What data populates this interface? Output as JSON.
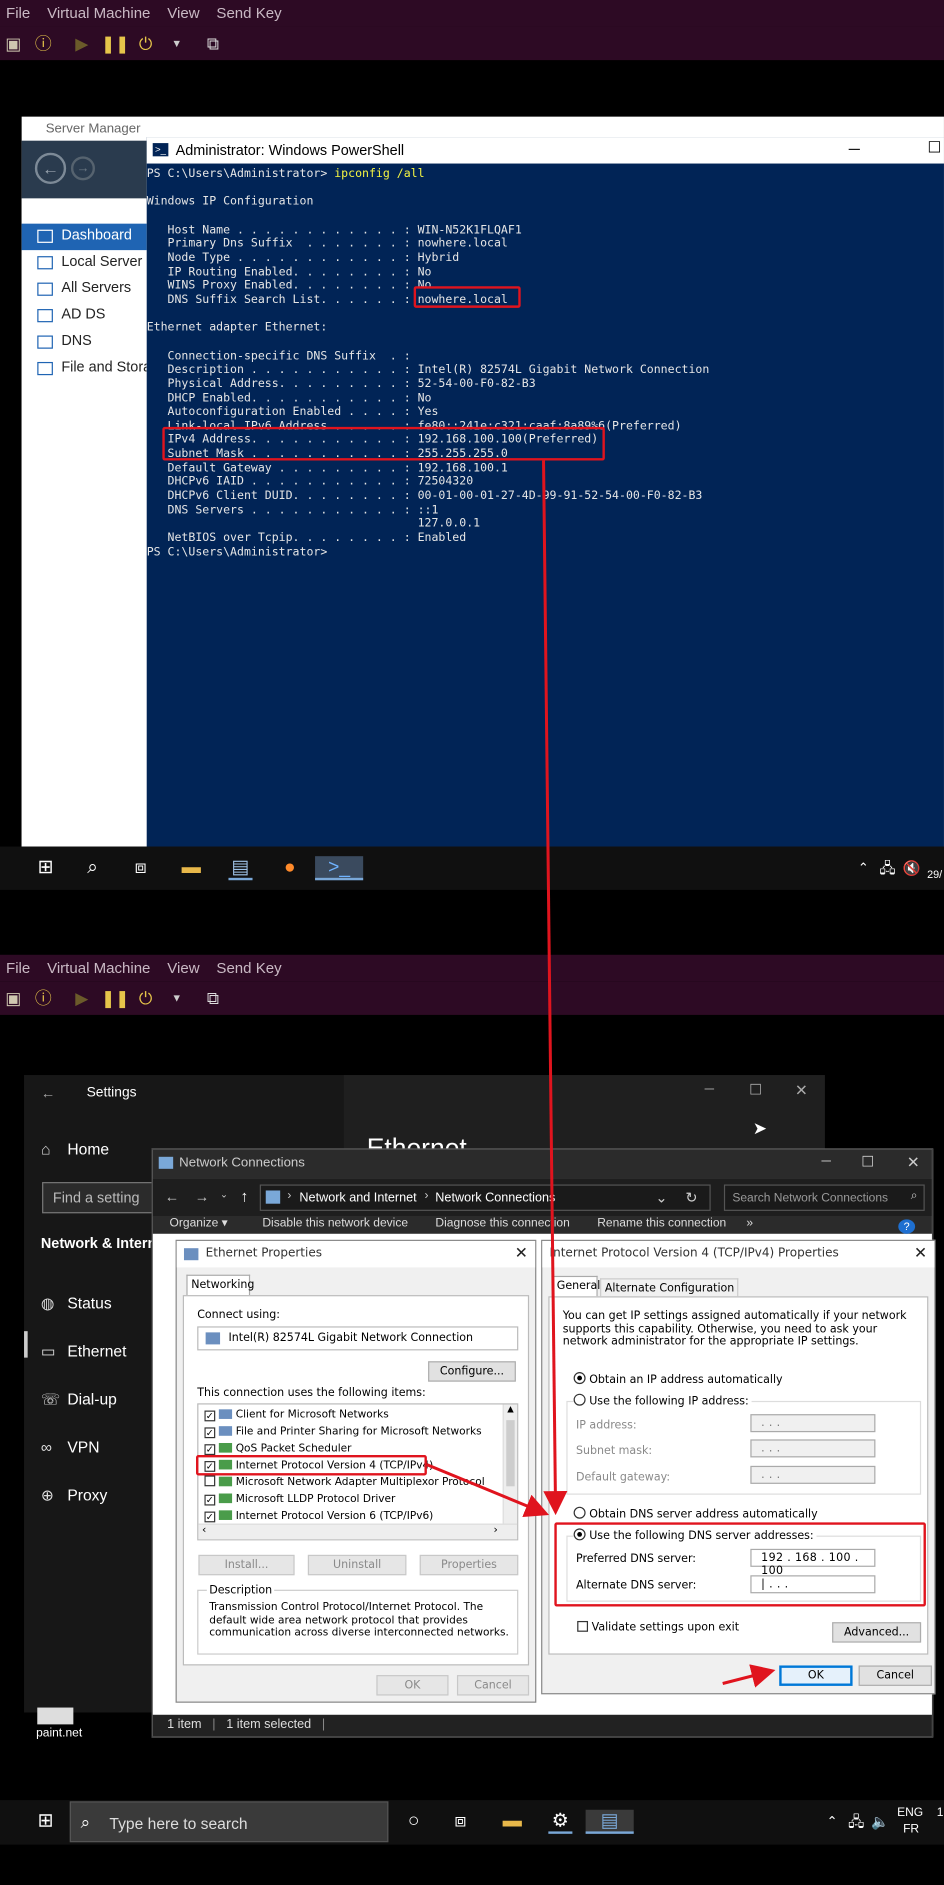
{
  "vm_top": {
    "menu": [
      "File",
      "Virtual Machine",
      "View",
      "Send Key"
    ]
  },
  "vm_bottom": {
    "menu": [
      "File",
      "Virtual Machine",
      "View",
      "Send Key"
    ]
  },
  "server_manager": {
    "title": "Server Manager",
    "items": [
      {
        "label": "Dashboard",
        "icon": "dashboard-icon"
      },
      {
        "label": "Local Server",
        "icon": "server-icon"
      },
      {
        "label": "All Servers",
        "icon": "servers-icon"
      },
      {
        "label": "AD DS",
        "icon": "adds-icon"
      },
      {
        "label": "DNS",
        "icon": "dns-icon"
      },
      {
        "label": "File and Stora",
        "icon": "files-icon"
      }
    ]
  },
  "powershell": {
    "title": "Administrator: Windows PowerShell",
    "prompt1": "PS C:\\Users\\Administrator> ",
    "command": "ipconfig /all",
    "lines": [
      "",
      "Windows IP Configuration",
      "",
      "   Host Name . . . . . . . . . . . . : WIN-N52K1FLQAF1",
      "   Primary Dns Suffix  . . . . . . . : nowhere.local",
      "   Node Type . . . . . . . . . . . . : Hybrid",
      "   IP Routing Enabled. . . . . . . . : No",
      "   WINS Proxy Enabled. . . . . . . . : No",
      "   DNS Suffix Search List. . . . . . : nowhere.local",
      "",
      "Ethernet adapter Ethernet:",
      "",
      "   Connection-specific DNS Suffix  . :",
      "   Description . . . . . . . . . . . : Intel(R) 82574L Gigabit Network Connection",
      "   Physical Address. . . . . . . . . : 52-54-00-F0-82-B3",
      "   DHCP Enabled. . . . . . . . . . . : No",
      "   Autoconfiguration Enabled . . . . : Yes",
      "   Link-local IPv6 Address . . . . . : fe80::241e:c321:caaf:8a89%6(Preferred)",
      "   IPv4 Address. . . . . . . . . . . : 192.168.100.100(Preferred)",
      "   Subnet Mask . . . . . . . . . . . : 255.255.255.0",
      "   Default Gateway . . . . . . . . . : 192.168.100.1",
      "   DHCPv6 IAID . . . . . . . . . . . : 72504320",
      "   DHCPv6 Client DUID. . . . . . . . : 00-01-00-01-27-4D-99-91-52-54-00-F0-82-B3",
      "   DNS Servers . . . . . . . . . . . : ::1",
      "                                       127.0.0.1",
      "   NetBIOS over Tcpip. . . . . . . . : Enabled",
      "PS C:\\Users\\Administrator>"
    ]
  },
  "taskbar_top": {
    "clock_partial": "29/"
  },
  "settings": {
    "title": "Settings",
    "home": "Home",
    "search_placeholder": "Find a setting",
    "section": "Network & Intern",
    "items": [
      "Status",
      "Ethernet",
      "Dial-up",
      "VPN",
      "Proxy"
    ],
    "page_heading_partial": "Ethernet"
  },
  "network_connections": {
    "title": "Network Connections",
    "breadcrumb": [
      "Network and Internet",
      "Network Connections"
    ],
    "search_placeholder": "Search Network Connections",
    "commands": [
      "Organize ▾",
      "Disable this network device",
      "Diagnose this connection",
      "Rename this connection",
      "»"
    ],
    "status_items": "1 item",
    "status_selected": "1 item selected"
  },
  "ethernet_props": {
    "title": "Ethernet Properties",
    "tab": "Networking",
    "connect_using_label": "Connect using:",
    "adapter": "Intel(R) 82574L Gigabit Network Connection",
    "configure": "Configure...",
    "items_label": "This connection uses the following items:",
    "items": [
      {
        "label": "Client for Microsoft Networks",
        "checked": true
      },
      {
        "label": "File and Printer Sharing for Microsoft Networks",
        "checked": true
      },
      {
        "label": "QoS Packet Scheduler",
        "checked": true
      },
      {
        "label": "Internet Protocol Version 4 (TCP/IPv4)",
        "checked": true
      },
      {
        "label": "Microsoft Network Adapter Multiplexor Protocol",
        "checked": false
      },
      {
        "label": "Microsoft LLDP Protocol Driver",
        "checked": true
      },
      {
        "label": "Internet Protocol Version 6 (TCP/IPv6)",
        "checked": true
      }
    ],
    "install": "Install...",
    "uninstall": "Uninstall",
    "properties": "Properties",
    "description_label": "Description",
    "description": "Transmission Control Protocol/Internet Protocol. The default wide area network protocol that provides communication across diverse interconnected networks.",
    "ok": "OK",
    "cancel": "Cancel"
  },
  "ipv4_props": {
    "title": "Internet Protocol Version 4 (TCP/IPv4) Properties",
    "tabs": [
      "General",
      "Alternate Configuration"
    ],
    "intro": "You can get IP settings assigned automatically if your network supports this capability. Otherwise, you need to ask your network administrator for the appropriate IP settings.",
    "auto_ip": "Obtain an IP address automatically",
    "manual_ip": "Use the following IP address:",
    "ip_label": "IP address:",
    "mask_label": "Subnet mask:",
    "gw_label": "Default gateway:",
    "empty_ip": ".      .      .",
    "auto_dns": "Obtain DNS server address automatically",
    "manual_dns": "Use the following DNS server addresses:",
    "pref_dns_label": "Preferred DNS server:",
    "pref_dns": "192 . 168 . 100 . 100",
    "alt_dns_label": "Alternate DNS server:",
    "alt_dns": "|      .      .      .",
    "validate": "Validate settings upon exit",
    "advanced": "Advanced...",
    "ok": "OK",
    "cancel": "Cancel"
  },
  "desktop": {
    "paint_label": "paint.net"
  },
  "taskbar_bottom": {
    "search_placeholder": "Type here to search",
    "lang1": "ENG",
    "lang2": "FR",
    "clock_partial": "1"
  },
  "colors": {
    "highlight": "#e0141e",
    "ps_bg": "#012456",
    "vm_chrome": "#2d0a24"
  }
}
